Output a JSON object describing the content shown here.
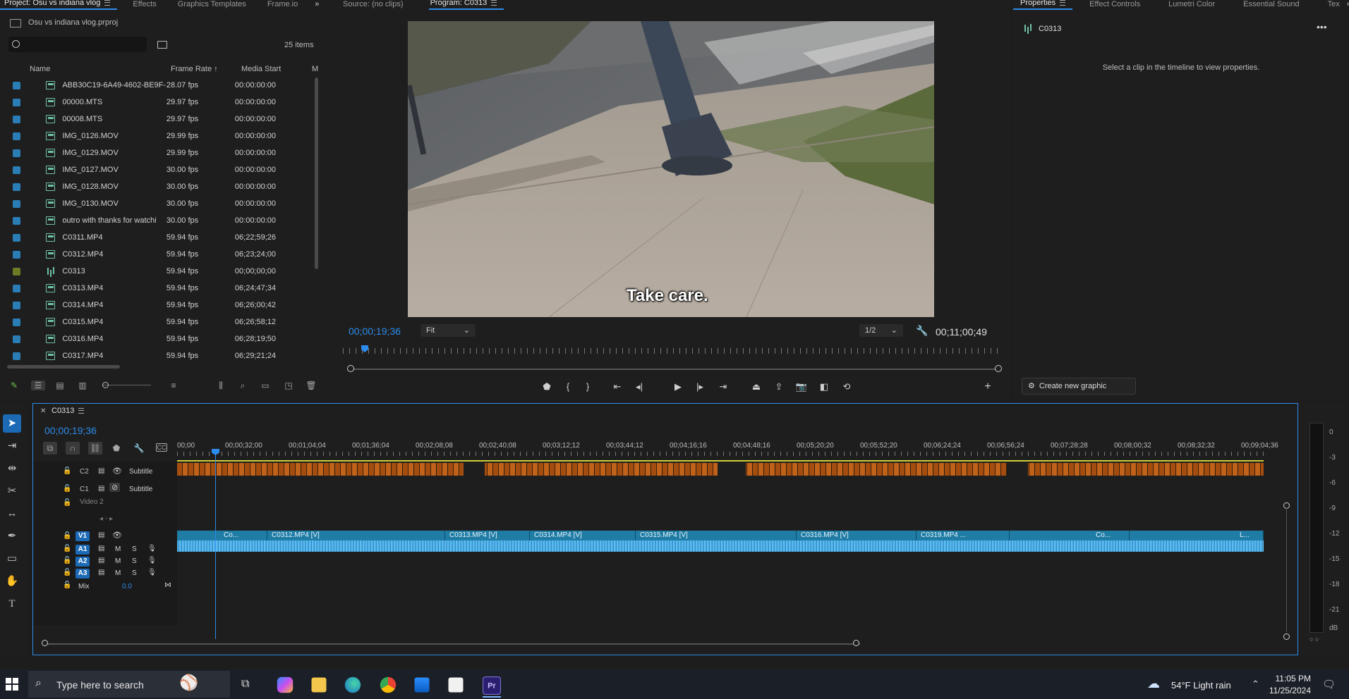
{
  "project_panel": {
    "tabs": [
      "Project: Osu vs indiana vlog",
      "Effects",
      "Graphics Templates",
      "Frame.io"
    ],
    "project_file": "Osu vs indiana vlog.prproj",
    "item_count": "25 items",
    "columns": {
      "name": "Name",
      "frame_rate": "Frame Rate",
      "media_start": "Media Start",
      "more": "M"
    },
    "items": [
      {
        "name": "ABB30C19-6A49-4602-BE9F-",
        "fps": "28.07 fps",
        "start": "00:00:00:00",
        "type": "clip"
      },
      {
        "name": "00000.MTS",
        "fps": "29.97 fps",
        "start": "00:00:00:00",
        "type": "clip"
      },
      {
        "name": "00008.MTS",
        "fps": "29.97 fps",
        "start": "00:00:00:00",
        "type": "clip"
      },
      {
        "name": "IMG_0126.MOV",
        "fps": "29.99 fps",
        "start": "00:00:00:00",
        "type": "clip"
      },
      {
        "name": "IMG_0129.MOV",
        "fps": "29.99 fps",
        "start": "00:00:00:00",
        "type": "clip"
      },
      {
        "name": "IMG_0127.MOV",
        "fps": "30.00 fps",
        "start": "00:00:00:00",
        "type": "clip"
      },
      {
        "name": "IMG_0128.MOV",
        "fps": "30.00 fps",
        "start": "00:00:00:00",
        "type": "clip"
      },
      {
        "name": "IMG_0130.MOV",
        "fps": "30.00 fps",
        "start": "00:00:00:00",
        "type": "clip"
      },
      {
        "name": "outro with thanks for watchi",
        "fps": "30.00 fps",
        "start": "00:00:00:00",
        "type": "clip"
      },
      {
        "name": "C0311.MP4",
        "fps": "59.94 fps",
        "start": "06;22;59;26",
        "type": "clip"
      },
      {
        "name": "C0312.MP4",
        "fps": "59.94 fps",
        "start": "06;23;24;00",
        "type": "clip"
      },
      {
        "name": "C0313",
        "fps": "59.94 fps",
        "start": "00;00;00;00",
        "type": "sequence"
      },
      {
        "name": "C0313.MP4",
        "fps": "59.94 fps",
        "start": "06;24;47;34",
        "type": "clip"
      },
      {
        "name": "C0314.MP4",
        "fps": "59.94 fps",
        "start": "06;26;00;42",
        "type": "clip"
      },
      {
        "name": "C0315.MP4",
        "fps": "59.94 fps",
        "start": "06;26;58;12",
        "type": "clip"
      },
      {
        "name": "C0316.MP4",
        "fps": "59.94 fps",
        "start": "06;28;19;50",
        "type": "clip"
      },
      {
        "name": "C0317.MP4",
        "fps": "59.94 fps",
        "start": "06;29;21;24",
        "type": "clip"
      }
    ]
  },
  "program_monitor": {
    "tabs": [
      "Source: (no clips)",
      "Program: C0313"
    ],
    "caption": "Take care.",
    "current_time": "00;00;19;36",
    "fit": "Fit",
    "resolution": "1/2",
    "duration": "00;11;00;49"
  },
  "properties_panel": {
    "tabs": [
      "Properties",
      "Effect Controls",
      "Lumetri Color",
      "Essential Sound",
      "Tex"
    ],
    "sequence_name": "C0313",
    "message": "Select a clip in the timeline to view properties.",
    "create_button": "Create new graphic"
  },
  "timeline": {
    "sequence_tab": "C0313",
    "timecode": "00;00;19;36",
    "ruler": [
      "00;00",
      "00;00;32;00",
      "00;01;04;04",
      "00;01;36;04",
      "00;02;08;08",
      "00;02;40;08",
      "00;03;12;12",
      "00;03;44;12",
      "00;04;16;16",
      "00;04;48;16",
      "00;05;20;20",
      "00;05;52;20",
      "00;06;24;24",
      "00;06;56;24",
      "00;07;28;28",
      "00;08;00;32",
      "00;08;32;32",
      "00;09;04;36"
    ],
    "tracks": {
      "c2": {
        "id": "C2",
        "name": "Subtitle"
      },
      "c1": {
        "id": "C1",
        "name": "Subtitle"
      },
      "v2": {
        "name": "Video 2"
      },
      "v1": "V1",
      "a1": "A1",
      "a2": "A2",
      "a3": "A3",
      "mute": "M",
      "solo": "S",
      "mix": "Mix",
      "mix_value": "0.0"
    },
    "clips": [
      "Co...",
      "C0312.MP4 [V]",
      "C0313.MP4 [V]",
      "C0314.MP4 [V]",
      "C0315.MP4 [V]",
      "C0316.MP4 [V]",
      "C0319.MP4 ...",
      "Co...",
      "L..."
    ]
  },
  "meter": {
    "labels": [
      "0",
      "-3",
      "-6",
      "-9",
      "-12",
      "-15",
      "-18",
      "-21",
      "dB"
    ]
  },
  "taskbar": {
    "search_placeholder": "Type here to search",
    "weather": "54°F  Light rain",
    "time": "11:05 PM",
    "date": "11/25/2024"
  }
}
